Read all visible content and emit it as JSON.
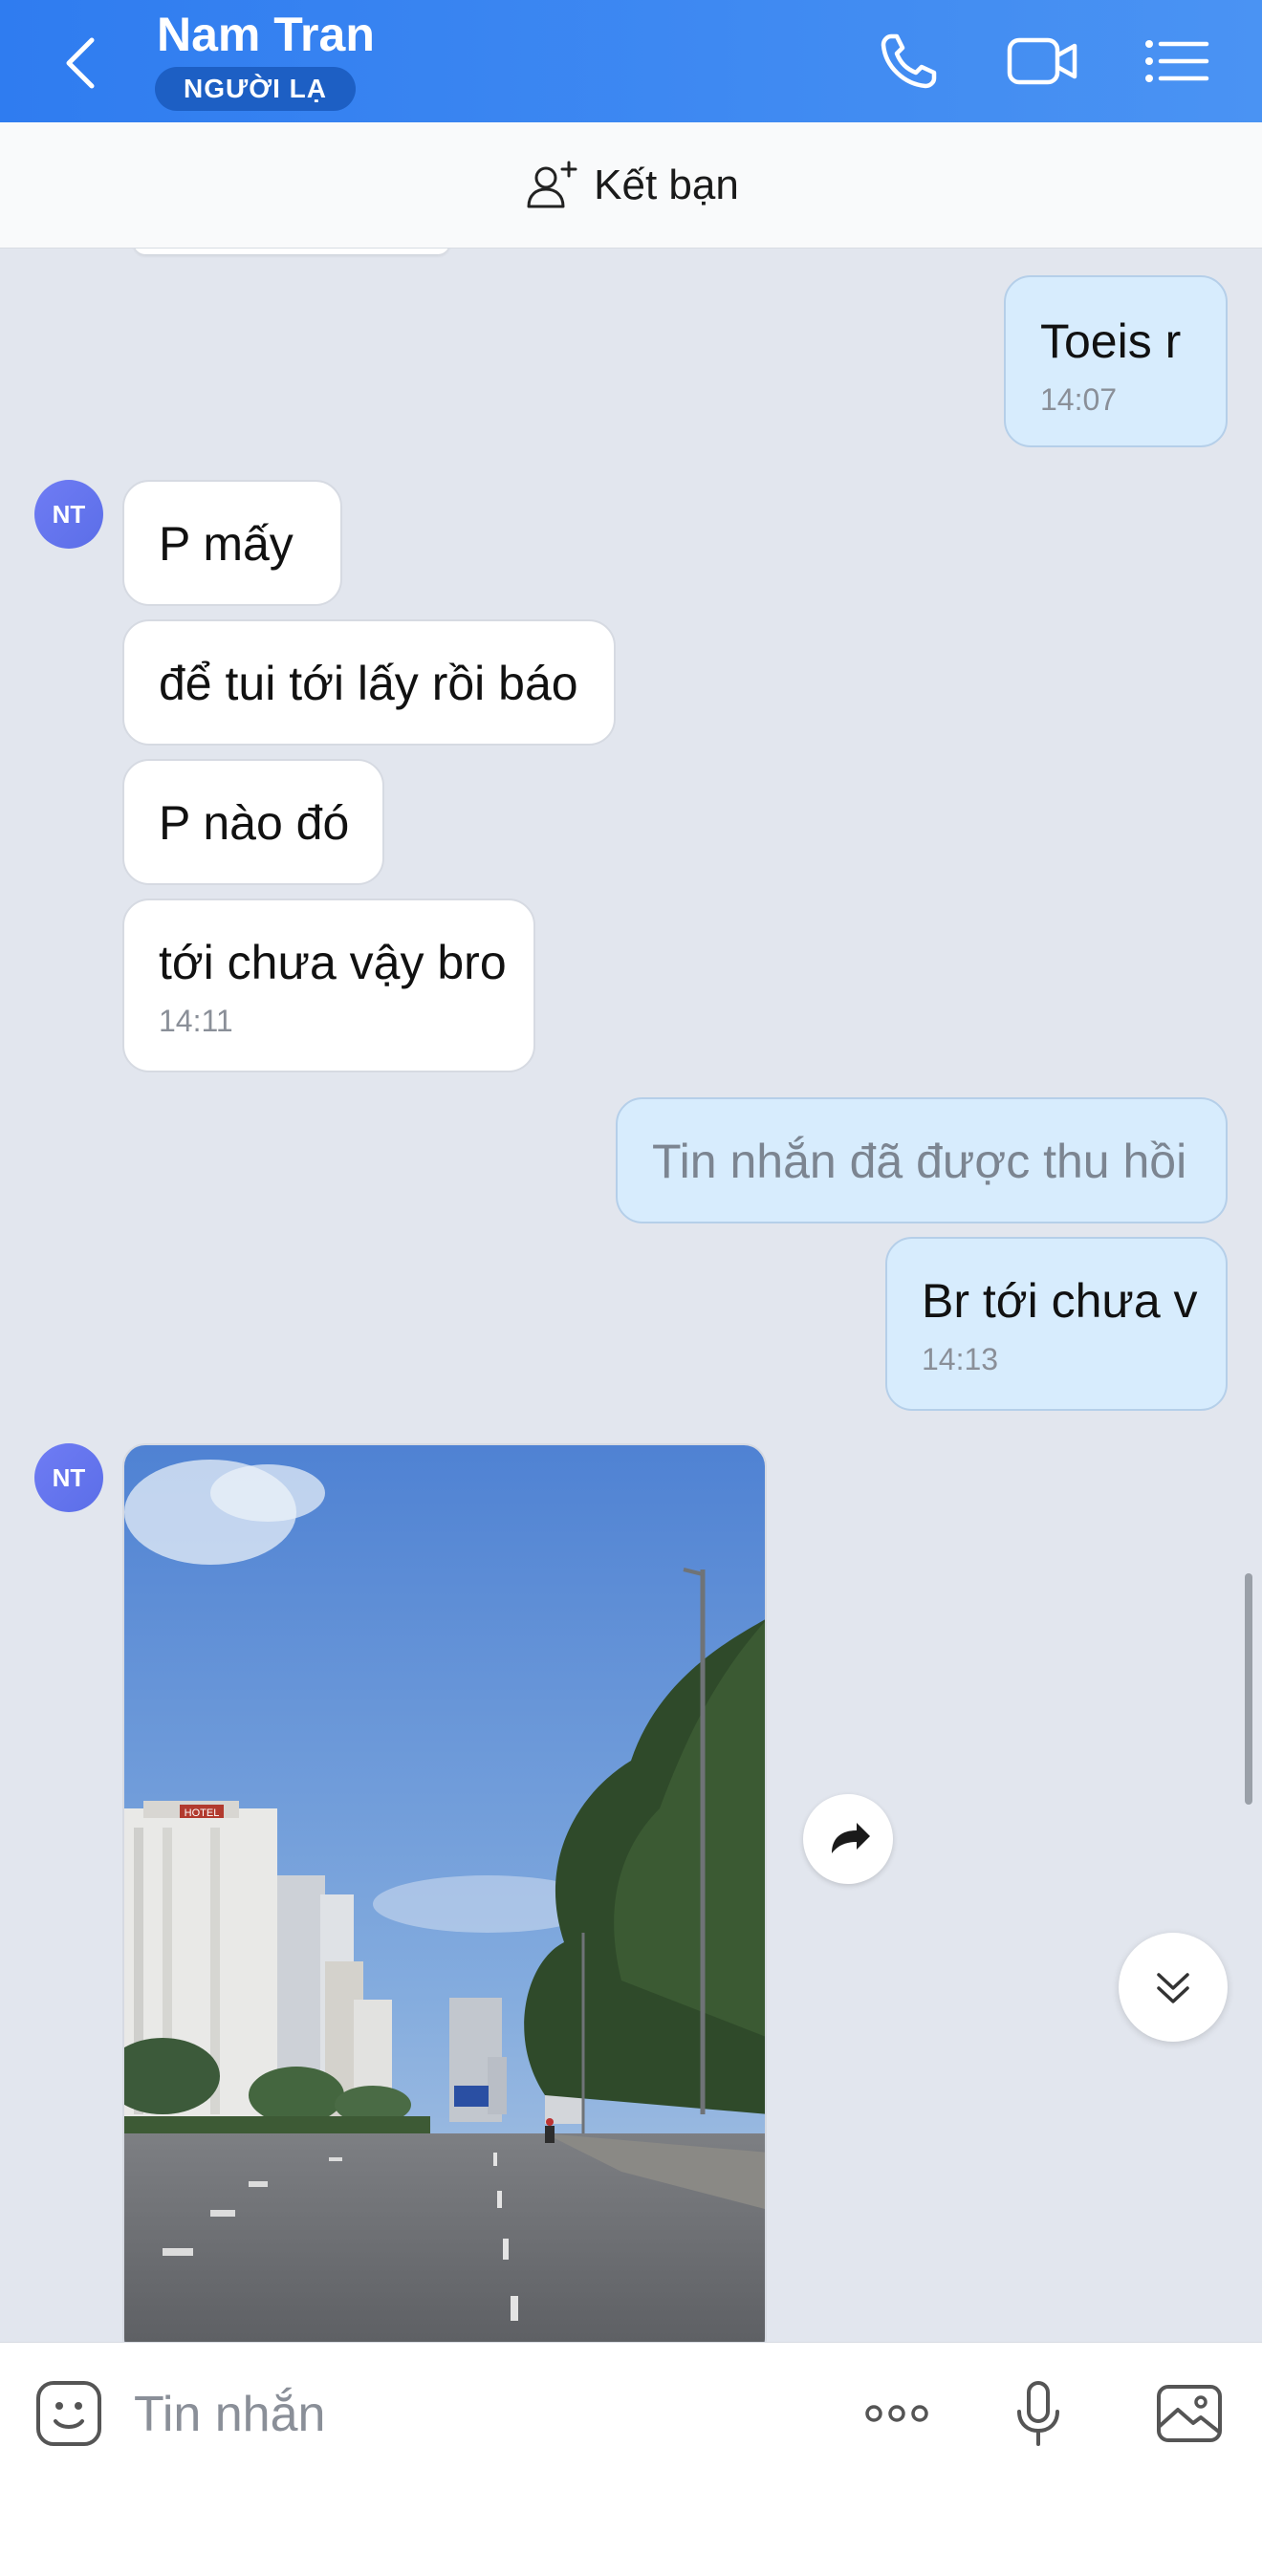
{
  "header": {
    "contact_name": "Nam Tran",
    "status_badge": "NGƯỜI LẠ",
    "bg_color": "#2f7cf0"
  },
  "friend_bar": {
    "label": "Kết bạn"
  },
  "messages": [
    {
      "side": "out",
      "text": "Toeis r",
      "time": "14:07"
    },
    {
      "side": "in",
      "text": "P mấy"
    },
    {
      "side": "in",
      "text": "để tui tới lấy rồi báo"
    },
    {
      "side": "in",
      "text": "P nào đó"
    },
    {
      "side": "in",
      "text": "tới chưa vậy bro",
      "time": "14:11"
    },
    {
      "side": "out",
      "text": "Tin nhắn đã được thu hồi",
      "recalled": true
    },
    {
      "side": "out",
      "text": "Br tới chưa v",
      "time": "14:13"
    },
    {
      "side": "in",
      "type": "photo"
    }
  ],
  "avatar_initials": "NT",
  "photo_sign_text": "HOTEL",
  "composer": {
    "placeholder": "Tin nhắn",
    "value": ""
  },
  "icons": {
    "back": "chevron-left-icon",
    "call": "phone-icon",
    "video": "video-camera-icon",
    "menu": "list-menu-icon",
    "add_friend": "add-user-icon",
    "share": "forward-arrow-icon",
    "scroll": "double-chevron-down-icon",
    "sticker": "sticker-icon",
    "more": "more-dots-icon",
    "mic": "microphone-icon",
    "gallery": "image-gallery-icon"
  }
}
